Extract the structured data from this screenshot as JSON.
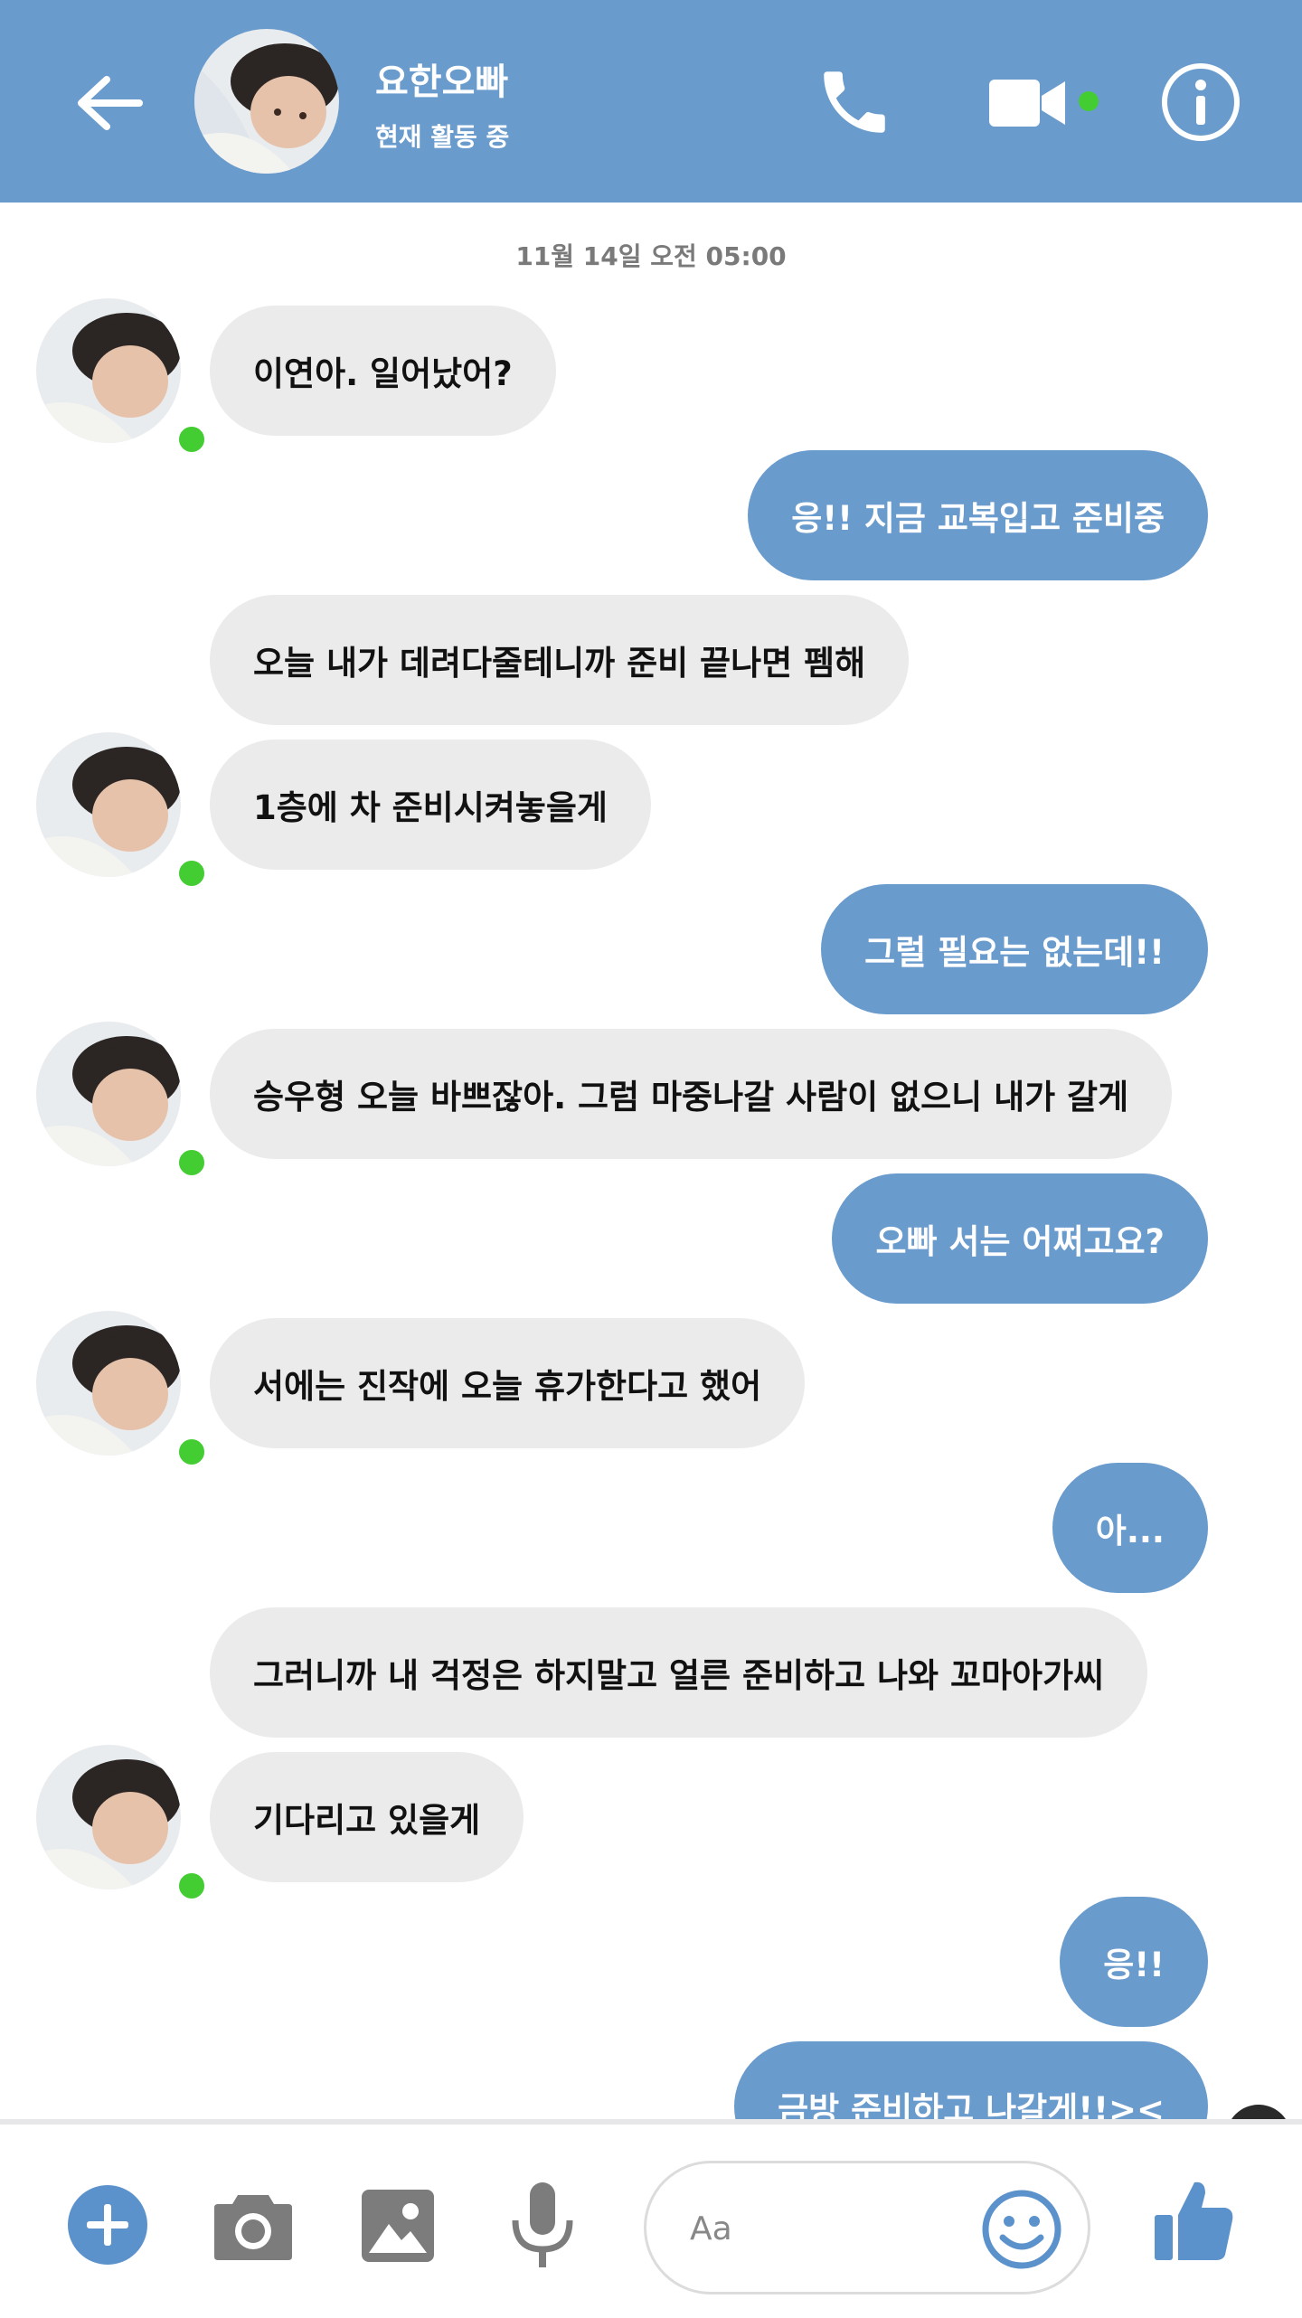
{
  "header": {
    "name": "요한오빠",
    "status": "현재 활동 중",
    "accent_color": "#6a9bcd",
    "online_color": "#44cc33"
  },
  "timestamp": "11월 14일 오전 05:00",
  "messages": [
    {
      "side": "in",
      "text": "이연아. 일어났어?"
    },
    {
      "side": "out",
      "text": "응!! 지금 교복입고 준비중"
    },
    {
      "side": "in",
      "text": "오늘 내가 데려다줄테니까 준비 끝나면 펨해"
    },
    {
      "side": "in",
      "text": "1층에 차 준비시켜놓을게"
    },
    {
      "side": "out",
      "text": "그럴 필요는 없는데!!"
    },
    {
      "side": "in",
      "text": "승우형 오늘 바쁘잖아. 그럼 마중나갈 사람이 없으니 내가 갈게"
    },
    {
      "side": "out",
      "text": "오빠 서는 어쩌고요?"
    },
    {
      "side": "in",
      "text": "서에는 진작에 오늘 휴가한다고 했어"
    },
    {
      "side": "out",
      "text": "아..."
    },
    {
      "side": "in",
      "text": "그러니까 내 걱정은 하지말고 얼른 준비하고 나와 꼬마아가씨"
    },
    {
      "side": "in",
      "text": "기다리고 있을게"
    },
    {
      "side": "out",
      "text": "응!!"
    },
    {
      "side": "out",
      "text": "금방 준비하고 나갈게!!><"
    }
  ],
  "composer": {
    "placeholder": "Aa",
    "icons": [
      "plus-icon",
      "camera-icon",
      "image-icon",
      "microphone-icon",
      "emoji-icon",
      "thumbs-up-icon"
    ]
  }
}
